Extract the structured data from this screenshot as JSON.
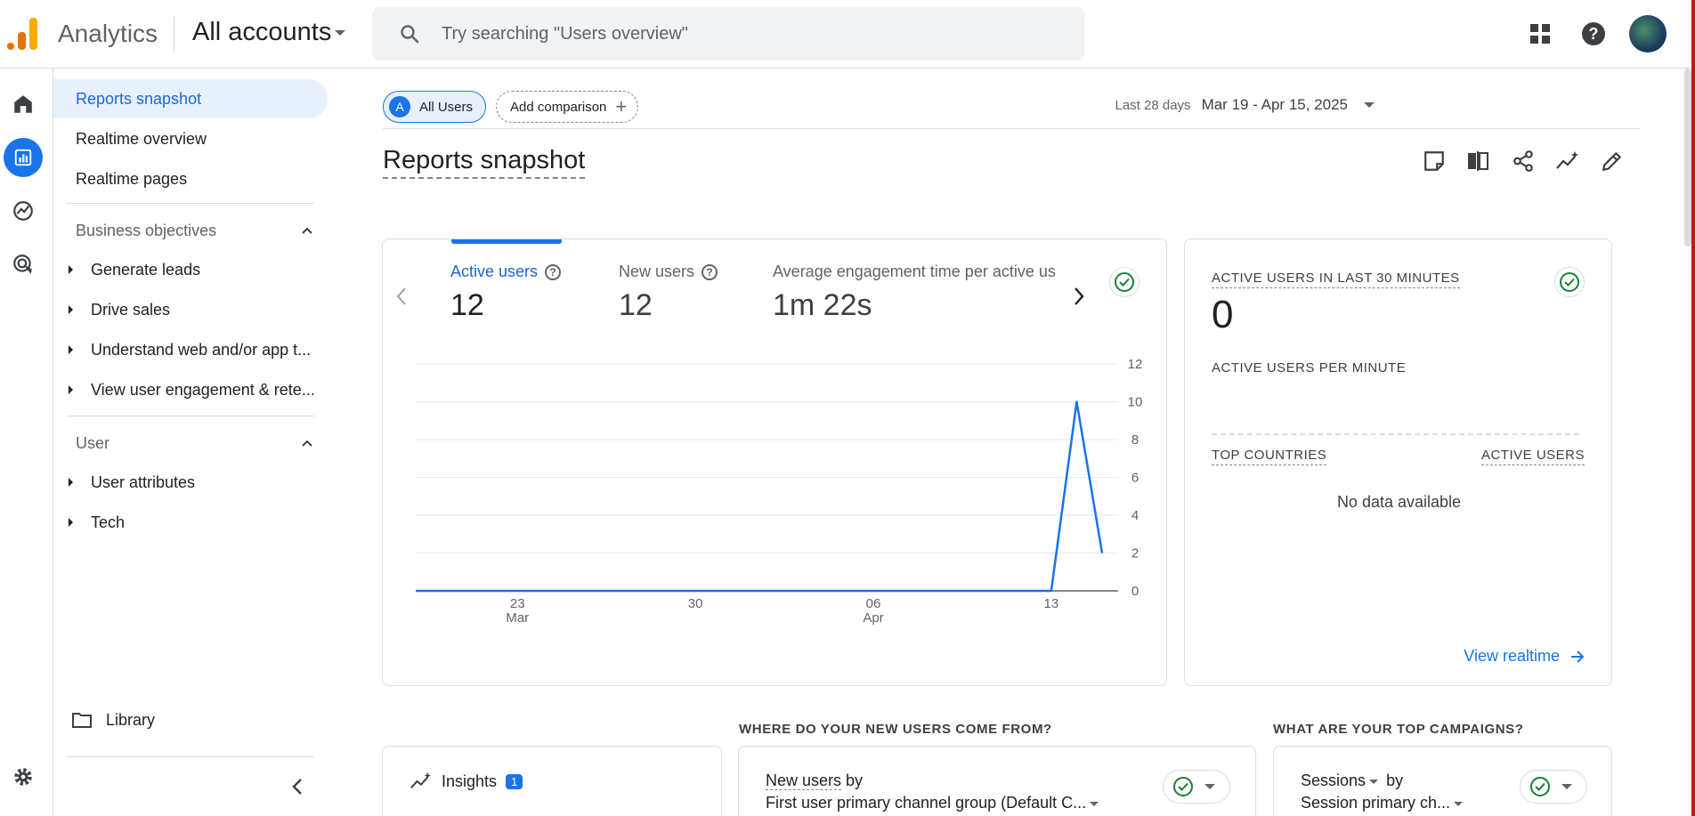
{
  "header": {
    "app_name": "Analytics",
    "account": "All accounts",
    "search_placeholder": "Try searching \"Users overview\""
  },
  "nav": {
    "items": [
      {
        "label": "Reports snapshot",
        "active": true
      },
      {
        "label": "Realtime overview"
      },
      {
        "label": "Realtime pages"
      }
    ],
    "sections": [
      {
        "title": "Business objectives",
        "items": [
          "Generate leads",
          "Drive sales",
          "Understand web and/or app t...",
          "View user engagement & rete..."
        ]
      },
      {
        "title": "User",
        "items": [
          "User attributes",
          "Tech"
        ]
      }
    ],
    "library": "Library"
  },
  "toolbar": {
    "segment_badge": "A",
    "segment": "All Users",
    "add_comparison": "Add comparison",
    "date_label": "Last 28 days",
    "date_range": "Mar 19 - Apr 15, 2025"
  },
  "page": {
    "title": "Reports snapshot"
  },
  "metrics": [
    {
      "label": "Active users",
      "value": "12"
    },
    {
      "label": "New users",
      "value": "12"
    },
    {
      "label": "Average engagement time per active us",
      "value": "1m 22s"
    }
  ],
  "chart_data": {
    "type": "line",
    "x": [
      "Mar 19",
      "Mar 20",
      "Mar 21",
      "Mar 22",
      "Mar 23",
      "Mar 24",
      "Mar 25",
      "Mar 26",
      "Mar 27",
      "Mar 28",
      "Mar 29",
      "Mar 30",
      "Mar 31",
      "Apr 01",
      "Apr 02",
      "Apr 03",
      "Apr 04",
      "Apr 05",
      "Apr 06",
      "Apr 07",
      "Apr 08",
      "Apr 09",
      "Apr 10",
      "Apr 11",
      "Apr 12",
      "Apr 13",
      "Apr 14",
      "Apr 15"
    ],
    "series": [
      {
        "values": [
          0,
          0,
          0,
          0,
          0,
          0,
          0,
          0,
          0,
          0,
          0,
          0,
          0,
          0,
          0,
          0,
          0,
          0,
          0,
          0,
          0,
          0,
          0,
          0,
          0,
          0,
          10,
          2
        ]
      }
    ],
    "y_ticks": [
      "0",
      "2",
      "4",
      "6",
      "8",
      "10",
      "12"
    ],
    "ylim": [
      0,
      12
    ],
    "x_ticks": [
      {
        "day": "23",
        "month": "Mar",
        "x": "Mar 23"
      },
      {
        "day": "30",
        "month": "",
        "x": "Mar 30"
      },
      {
        "day": "06",
        "month": "Apr",
        "x": "Apr 06"
      },
      {
        "day": "13",
        "month": "",
        "x": "Apr 13"
      }
    ],
    "grid": true,
    "color": "#1a73e8"
  },
  "realtime": {
    "title": "ACTIVE USERS IN LAST 30 MINUTES",
    "value": "0",
    "per_minute": "ACTIVE USERS PER MINUTE",
    "col_countries": "TOP COUNTRIES",
    "col_users": "ACTIVE USERS",
    "no_data": "No data available",
    "link": "View realtime"
  },
  "bottom": {
    "new_users_heading": "WHERE DO YOUR NEW USERS COME FROM?",
    "campaigns_heading": "WHAT ARE YOUR TOP CAMPAIGNS?",
    "insights": "Insights",
    "insights_count": "1",
    "new_users_metric": "New users",
    "by": "by",
    "new_users_dim": "First user primary channel group (Default C...",
    "sessions_metric": "Sessions",
    "sessions_dim": "Session primary ch..."
  },
  "colors": {
    "accent": "#1a73e8",
    "success": "#188038",
    "logo_orange": "#e37400",
    "logo_yellow": "#f9ab00"
  }
}
